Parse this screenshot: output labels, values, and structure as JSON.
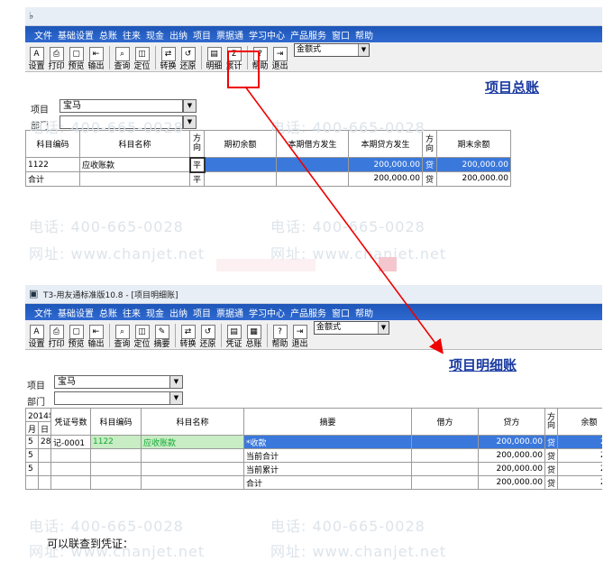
{
  "menu_items": [
    "文件",
    "基础设置",
    "总账",
    "往来",
    "现金",
    "出纳",
    "项目",
    "票据通",
    "学习中心",
    "产品服务",
    "窗口",
    "帮助"
  ],
  "win1": {
    "toolbar": [
      {
        "label": "设置",
        "icon": "A"
      },
      {
        "label": "打印",
        "icon": "⎙"
      },
      {
        "label": "预览",
        "icon": "▢"
      },
      {
        "label": "输出",
        "icon": "⇤"
      },
      {
        "label": "查询",
        "icon": "⌕"
      },
      {
        "label": "定位",
        "icon": "◫"
      },
      {
        "label": "转换",
        "icon": "⇄"
      },
      {
        "label": "还原",
        "icon": "↺"
      },
      {
        "label": "明细",
        "icon": "▤"
      },
      {
        "label": "累计",
        "icon": "Σ"
      },
      {
        "label": "帮助",
        "icon": "?"
      },
      {
        "label": "退出",
        "icon": "⇥"
      }
    ],
    "format_select": "金额式",
    "report_title": "项目总账",
    "project_label": "项目",
    "project_value": "宝马",
    "dept_label": "部门",
    "dept_value": "",
    "columns": [
      "科目编码",
      "科目名称",
      "方向",
      "期初余额",
      "本期借方发生",
      "本期贷方发生",
      "方向",
      "期末余额"
    ],
    "rows": [
      [
        "1122",
        "应收账款",
        "平",
        "",
        "",
        "200,000.00",
        "贷",
        "200,000.00"
      ],
      [
        "合计",
        "",
        "平",
        "",
        "",
        "200,000.00",
        "贷",
        "200,000.00"
      ]
    ]
  },
  "win2": {
    "window_title": "T3-用友通标准版10.8 - [项目明细账]",
    "toolbar": [
      {
        "label": "设置",
        "icon": "A"
      },
      {
        "label": "打印",
        "icon": "⎙"
      },
      {
        "label": "预览",
        "icon": "▢"
      },
      {
        "label": "输出",
        "icon": "⇤"
      },
      {
        "label": "查询",
        "icon": "⌕"
      },
      {
        "label": "定位",
        "icon": "◫"
      },
      {
        "label": "摘要",
        "icon": "✎"
      },
      {
        "label": "转换",
        "icon": "⇄"
      },
      {
        "label": "还原",
        "icon": "↺"
      },
      {
        "label": "凭证",
        "icon": "▤"
      },
      {
        "label": "总账",
        "icon": "▦"
      },
      {
        "label": "帮助",
        "icon": "?"
      },
      {
        "label": "退出",
        "icon": "⇥"
      }
    ],
    "format_select": "金额式",
    "report_title": "项目明细账",
    "project_label": "项目",
    "project_value": "宝马",
    "dept_label": "部门",
    "dept_value": "",
    "year_header": "2014年",
    "month_header": "月",
    "day_header": "日",
    "columns": [
      "凭证号数",
      "科目编码",
      "科目名称",
      "摘要",
      "借方",
      "贷方",
      "方向",
      "余额"
    ],
    "rows": [
      [
        "5",
        "28",
        "记-0001",
        "1122",
        "应收账款",
        "*收款",
        "",
        "200,000.00",
        "贷",
        "200,"
      ],
      [
        "5",
        "",
        "",
        "",
        "",
        "当前合计",
        "",
        "200,000.00",
        "贷",
        "200,"
      ],
      [
        "5",
        "",
        "",
        "",
        "",
        "当前累计",
        "",
        "200,000.00",
        "贷",
        "200,"
      ],
      [
        "",
        "",
        "",
        "",
        "",
        "合计",
        "",
        "200,000.00",
        "贷",
        "200,"
      ]
    ]
  },
  "watermark_phone": "电话: 400-665-0028",
  "watermark_url": "网址: www.chanjet.net",
  "caption": "可以联查到凭证："
}
